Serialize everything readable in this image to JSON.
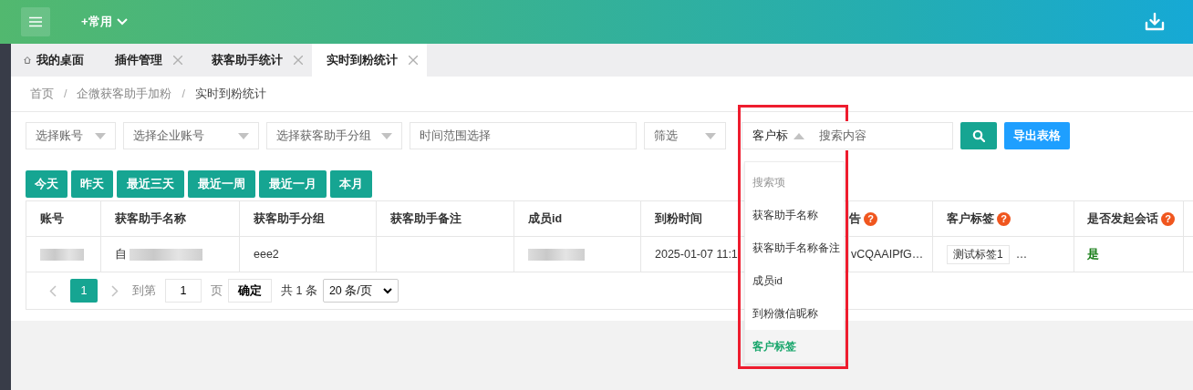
{
  "header": {
    "favorites_menu": "+常用"
  },
  "tabs": [
    {
      "label": "我的桌面",
      "kind": "home",
      "selected": false
    },
    {
      "label": "插件管理",
      "kind": "closable",
      "selected": false
    },
    {
      "label": "获客助手统计",
      "kind": "closable",
      "selected": false
    },
    {
      "label": "实时到粉统计",
      "kind": "closable",
      "selected": true
    }
  ],
  "breadcrumb": [
    {
      "kind": "link",
      "text": "首页"
    },
    {
      "kind": "separator",
      "text": "/"
    },
    {
      "kind": "link",
      "text": "企微获客助手加粉"
    },
    {
      "kind": "separator",
      "text": "/"
    },
    {
      "kind": "current",
      "text": "实时到粉统计"
    }
  ],
  "filters": [
    {
      "placeholder": "选择账号",
      "kind": "select"
    },
    {
      "placeholder": "选择企业账号",
      "kind": "select"
    },
    {
      "placeholder": "选择获客助手分组",
      "kind": "select"
    },
    {
      "placeholder": "时间范围选择",
      "kind": "input"
    },
    {
      "placeholder": "筛选",
      "kind": "select"
    }
  ],
  "search": {
    "field_select": "客户标",
    "placeholder": "搜索内容",
    "expanded": true,
    "options": [
      {
        "label": "搜索项",
        "kind": "heading"
      },
      {
        "label": "获客助手名称",
        "kind": "option",
        "selected": false
      },
      {
        "label": "获客助手名称备注",
        "kind": "option",
        "selected": false
      },
      {
        "label": "成员id",
        "kind": "option",
        "selected": false
      },
      {
        "label": "到粉微信昵称",
        "kind": "option",
        "selected": false
      },
      {
        "label": "客户标签",
        "kind": "option",
        "selected": true
      }
    ]
  },
  "export_button": "导出表格",
  "quick_dates": [
    "今天",
    "昨天",
    "最近三天",
    "最近一周",
    "最近一月",
    "本月"
  ],
  "table": {
    "columns": [
      {
        "label": "账号"
      },
      {
        "label": "获客助手名称"
      },
      {
        "label": "获客助手分组"
      },
      {
        "label": "获客助手备注"
      },
      {
        "label": "成员id"
      },
      {
        "label": "到粉时间"
      },
      {
        "label": "告",
        "help": "?"
      },
      {
        "label": "客户标签",
        "help": "?"
      },
      {
        "label": "是否发起会话",
        "help": "?"
      }
    ],
    "rows": [
      {
        "cells": [
          {
            "kind": "redacted"
          },
          {
            "kind": "partly_redacted",
            "text": "自"
          },
          {
            "kind": "text",
            "text": "eee2"
          },
          {
            "kind": "empty"
          },
          {
            "kind": "redacted"
          },
          {
            "kind": "text",
            "text": "2025-01-07 11:1"
          },
          {
            "kind": "text",
            "text": "vCQAAIPfG…"
          },
          {
            "kind": "tags",
            "tags": [
              "测试标签1"
            ],
            "more": "…"
          },
          {
            "kind": "yes",
            "text": "是"
          }
        ]
      }
    ]
  },
  "pagination": {
    "pages": [
      {
        "label": "1",
        "selected": true
      }
    ],
    "goto_label": "到第",
    "goto_value": "1",
    "page_suffix": "页",
    "confirm": "确定",
    "total": "共 1 条",
    "page_size": "20 条/页"
  }
}
